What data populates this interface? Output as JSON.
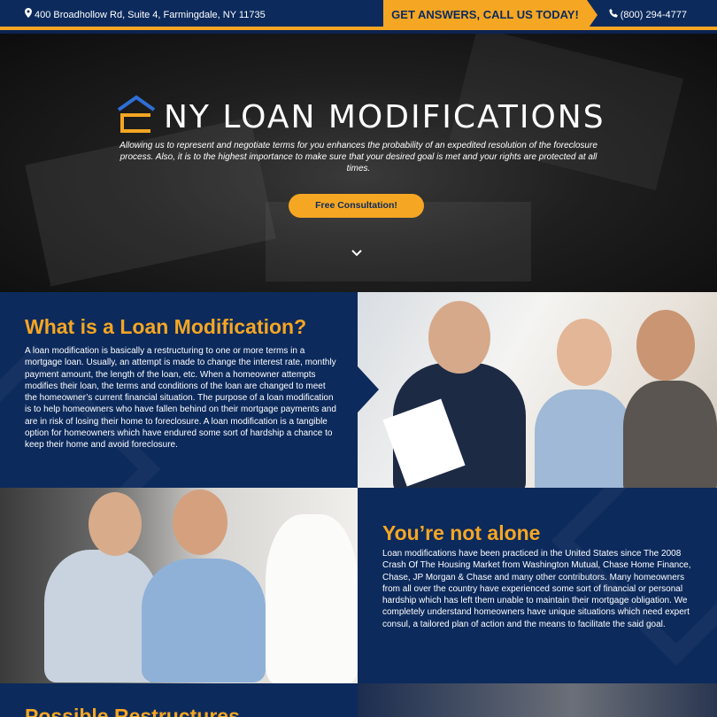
{
  "topbar": {
    "address": "400 Broadhollow Rd, Suite 4, Farmingdale, NY 11735",
    "cta": "GET ANSWERS, CALL US TODAY!",
    "phone": "(800) 294-4777",
    "icons": {
      "address": "map-marker-icon",
      "phone": "phone-icon"
    }
  },
  "hero": {
    "logo_text": "NY LOAN MODIFICATIONS",
    "tagline": "Allowing us to represent and negotiate terms for you enhances the probability of an expedited resolution of the foreclosure process. Also, it is to the highest importance to make sure that your desired goal is met and your rights are protected at all times.",
    "button": "Free Consultation!",
    "scroll_icon": "chevron-down-icon"
  },
  "sections": [
    {
      "title": "What is a Loan Modification?",
      "body": "A loan modification is basically a restructuring to one or more terms in a mortgage loan. Usually, an attempt is made to change the interest rate, monthly payment amount, the length of the loan, etc. When a homeowner attempts modifies their loan, the terms and conditions of the loan are changed to meet the homeowner’s current financial situation. The purpose of a loan modification is to help homeowners who have fallen behind on their mortgage payments and are in risk of losing their home to foreclosure. A loan modification is a tangible option for homeowners which have endured some sort of hardship a chance to keep their home and avoid foreclosure."
    },
    {
      "title": "You’re not alone",
      "body": "Loan modifications have been practiced in the United States since The 2008 Crash Of The Housing Market from Washington Mutual, Chase Home Finance, Chase, JP Morgan & Chase and many other contributors. Many homeowners from all over the country have experienced some sort of financial or personal hardship which has left them unable to maintain their mortgage obligation. We completely understand homeowners have unique situations which need expert consul, a tailored plan of action and the means to facilitate the said goal."
    },
    {
      "title": "Possible Restructures"
    }
  ],
  "colors": {
    "navy": "#0c2a5c",
    "accent": "#f5a623"
  }
}
